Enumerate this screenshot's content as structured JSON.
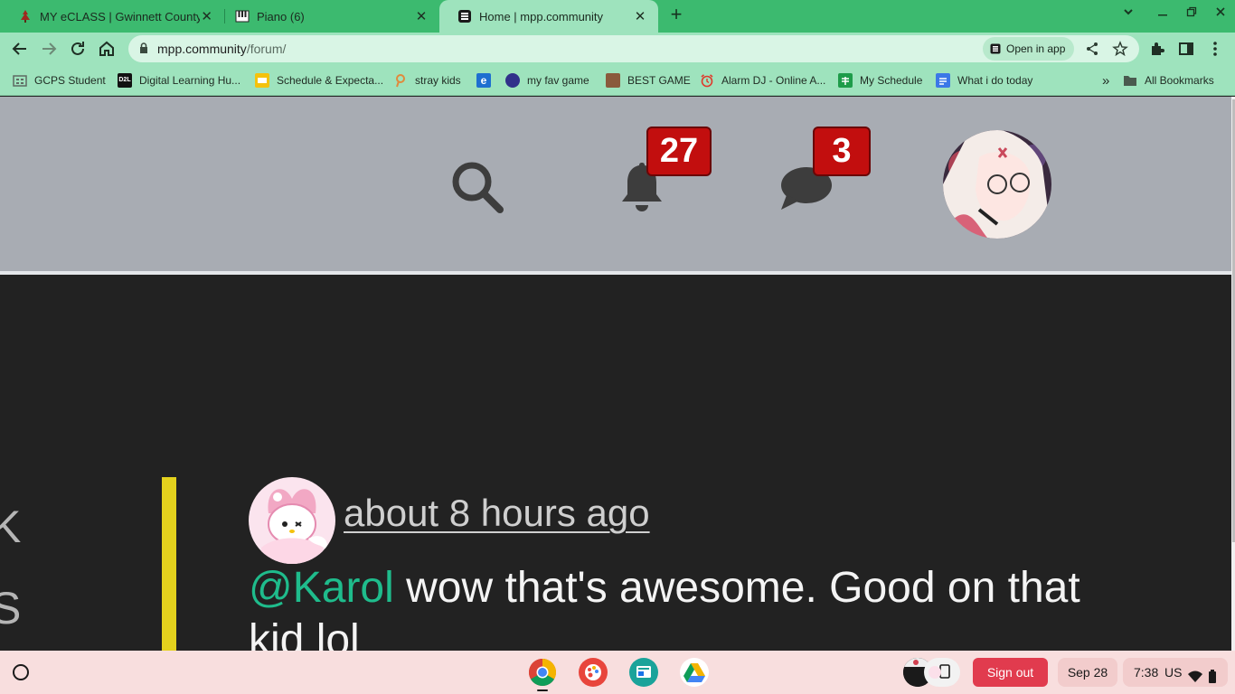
{
  "browser": {
    "tabs": [
      {
        "title": "MY eCLASS | Gwinnett County P",
        "active": false
      },
      {
        "title": "Piano (6)",
        "active": false
      },
      {
        "title": "Home | mpp.community",
        "active": true
      }
    ],
    "close_glyph": "✕",
    "new_tab_glyph": "+",
    "url_host": "mpp.community",
    "url_path": "/forum/",
    "open_in_app_label": "Open in app",
    "bookmarks": [
      {
        "label": "GCPS Student",
        "icon": "#5f6b63"
      },
      {
        "label": "Digital Learning Hu...",
        "icon": "#111111"
      },
      {
        "label": "Schedule & Expecta...",
        "icon": "#f4c20d"
      },
      {
        "label": "stray kids",
        "icon": "#e08a3c"
      },
      {
        "label": "",
        "icon": "#1e6fd0"
      },
      {
        "label": "my fav game",
        "icon": "#31318a"
      },
      {
        "label": "BEST GAME",
        "icon": "#8a5a3c"
      },
      {
        "label": "Alarm DJ - Online A...",
        "icon": "#e0392b"
      },
      {
        "label": "My Schedule",
        "icon": "#1e9c4a"
      },
      {
        "label": "What i do today",
        "icon": "#3b78e7"
      }
    ],
    "more_bookmarks_glyph": "»",
    "all_bookmarks_label": "All Bookmarks"
  },
  "header": {
    "notifications_count": "27",
    "messages_count": "3"
  },
  "post": {
    "timestamp": "about 8 hours ago",
    "mention": "@Karol",
    "body_line1": " wow that's awesome. Good on that",
    "body_line2": "kid lol"
  },
  "edge_text": [
    "K",
    "S"
  ],
  "shelf": {
    "sign_out_label": "Sign out",
    "date": "Sep 28",
    "time": "7:38",
    "locale": "US"
  },
  "colors": {
    "tabstrip": "#3cba6f",
    "toolbar": "#9ee3bd",
    "header_bg": "#a8acb3",
    "content_bg": "#222222",
    "badge_red": "#c20e0e",
    "mention_green": "#1fbc8c",
    "quote_bar": "#e4d21d",
    "sign_out_red": "#e13b4e"
  }
}
